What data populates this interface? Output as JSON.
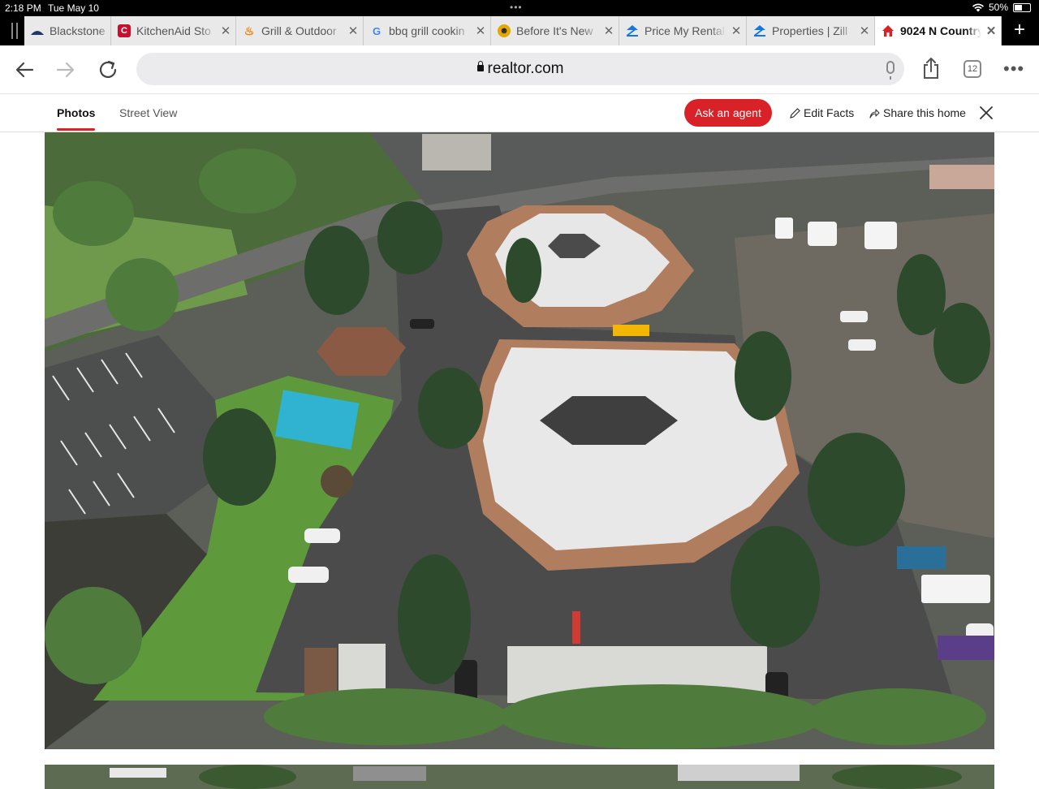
{
  "status_bar": {
    "time": "2:18 PM",
    "date": "Tue May 10",
    "battery": "50%"
  },
  "tabs": [
    {
      "title": "Blackstone",
      "icon": "blackstone-icon",
      "color": "#1d3a6b"
    },
    {
      "title": "KitchenAid Sto",
      "icon": "kitchenaid-icon",
      "color": "#c8102e"
    },
    {
      "title": "Grill & Outdoor",
      "icon": "fire-icon",
      "color": "#f57c00"
    },
    {
      "title": "bbq grill cookin",
      "icon": "google-icon",
      "color": "#4285f4"
    },
    {
      "title": "Before It's New",
      "icon": "before-its-news-icon",
      "color": "#e5a800"
    },
    {
      "title": "Price My Rental",
      "icon": "zillow-icon",
      "color": "#1277e1"
    },
    {
      "title": "Properties | Zill",
      "icon": "zillow-icon",
      "color": "#1277e1"
    },
    {
      "title": "9024 N Country",
      "icon": "realtor-house-icon",
      "color": "#d92228"
    }
  ],
  "address_bar": {
    "url": "realtor.com",
    "tab_count": "12"
  },
  "page_header": {
    "tabs": [
      "Photos",
      "Street View"
    ],
    "ask_agent": "Ask an agent",
    "edit_facts": "Edit Facts",
    "share": "Share this home"
  },
  "colors": {
    "brand_red": "#d92228",
    "tab_bg": "#e9e9ea"
  }
}
